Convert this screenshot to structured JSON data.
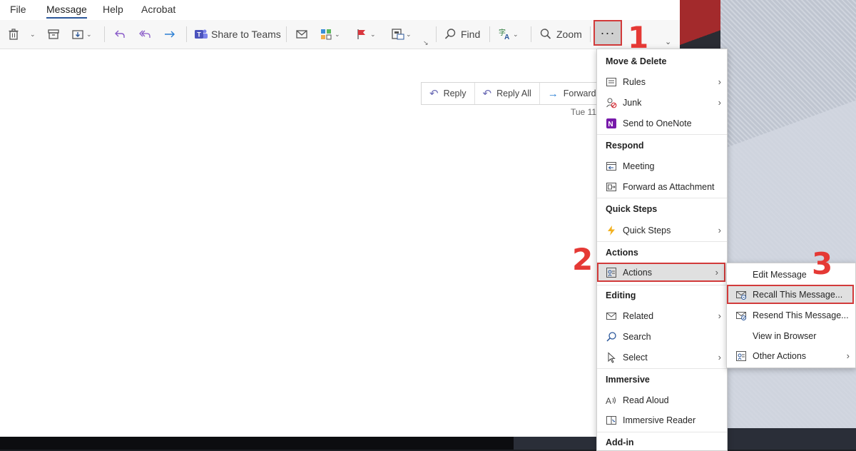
{
  "menubar": {
    "tabs": [
      "File",
      "Message",
      "Help",
      "Acrobat"
    ],
    "active": "Message"
  },
  "ribbon": {
    "share_teams": "Share to Teams",
    "find": "Find",
    "zoom": "Zoom",
    "more": "···"
  },
  "reading_pane": {
    "reply": "Reply",
    "reply_all": "Reply All",
    "forward": "Forward",
    "date": "Tue 11"
  },
  "main_menu": {
    "move_delete": "Move & Delete",
    "rules": "Rules",
    "junk": "Junk",
    "send_onenote": "Send to OneNote",
    "respond": "Respond",
    "meeting": "Meeting",
    "forward_attachment": "Forward as Attachment",
    "quick_steps_h": "Quick Steps",
    "quick_steps": "Quick Steps",
    "actions_h": "Actions",
    "actions": "Actions",
    "editing": "Editing",
    "related": "Related",
    "search": "Search",
    "select": "Select",
    "immersive": "Immersive",
    "read_aloud": "Read Aloud",
    "immersive_reader": "Immersive Reader",
    "addin": "Add-in"
  },
  "submenu": {
    "edit_message": "Edit Message",
    "recall": "Recall This Message...",
    "resend": "Resend This Message...",
    "view_browser": "View in Browser",
    "other_actions": "Other Actions"
  },
  "steps": [
    "1",
    "2",
    "3"
  ],
  "colors": {
    "accent": "#2b579a",
    "highlight_border": "#d23a3a",
    "step_red": "#e53935"
  }
}
